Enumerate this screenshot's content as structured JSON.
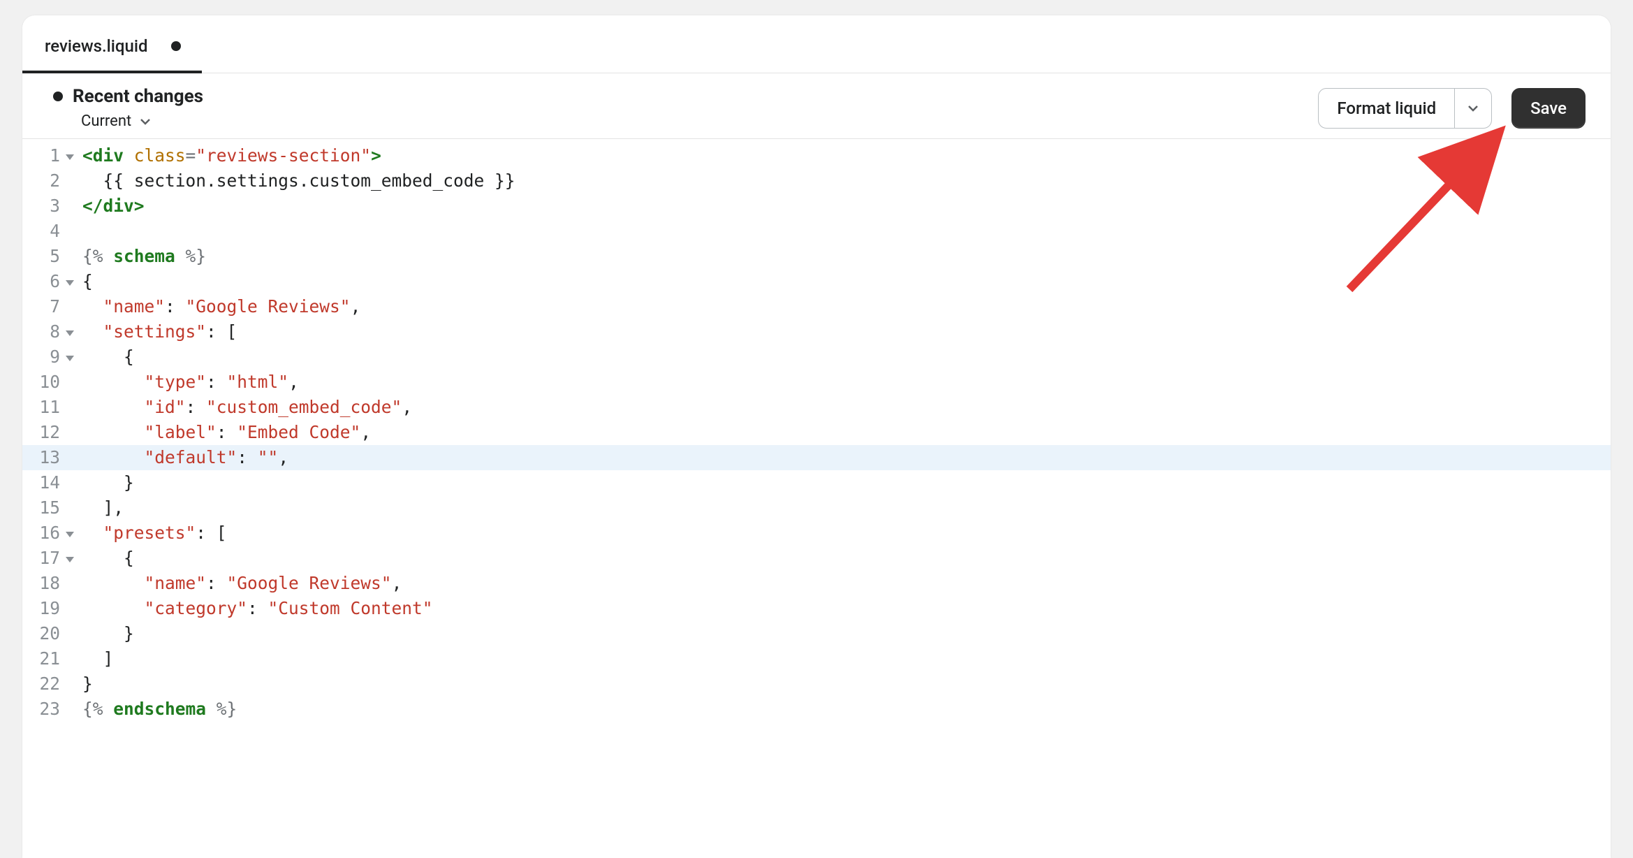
{
  "tab": {
    "filename": "reviews.liquid"
  },
  "toolbar": {
    "recent_title": "Recent changes",
    "current_label": "Current",
    "format_label": "Format liquid",
    "save_label": "Save"
  },
  "editor": {
    "highlighted_line": 13,
    "fold_lines": [
      1,
      6,
      8,
      9,
      16,
      17
    ],
    "lines": [
      {
        "num": 1,
        "tokens": [
          {
            "t": "<div ",
            "c": "tok-tag"
          },
          {
            "t": "class",
            "c": "tok-attr"
          },
          {
            "t": "=",
            "c": "tok-punct"
          },
          {
            "t": "\"reviews-section\"",
            "c": "tok-str"
          },
          {
            "t": ">",
            "c": "tok-tag"
          }
        ]
      },
      {
        "num": 2,
        "tokens": [
          {
            "t": "  {{ section.settings.custom_embed_code }}",
            "c": ""
          }
        ]
      },
      {
        "num": 3,
        "tokens": [
          {
            "t": "</div>",
            "c": "tok-tag"
          }
        ]
      },
      {
        "num": 4,
        "tokens": [
          {
            "t": "",
            "c": ""
          }
        ]
      },
      {
        "num": 5,
        "tokens": [
          {
            "t": "{% ",
            "c": "tok-punct"
          },
          {
            "t": "schema",
            "c": "tok-kw"
          },
          {
            "t": " %}",
            "c": "tok-punct"
          }
        ]
      },
      {
        "num": 6,
        "tokens": [
          {
            "t": "{",
            "c": ""
          }
        ]
      },
      {
        "num": 7,
        "tokens": [
          {
            "t": "  ",
            "c": ""
          },
          {
            "t": "\"name\"",
            "c": "tok-key"
          },
          {
            "t": ": ",
            "c": ""
          },
          {
            "t": "\"Google Reviews\"",
            "c": "tok-str"
          },
          {
            "t": ",",
            "c": ""
          }
        ]
      },
      {
        "num": 8,
        "tokens": [
          {
            "t": "  ",
            "c": ""
          },
          {
            "t": "\"settings\"",
            "c": "tok-key"
          },
          {
            "t": ": [",
            "c": ""
          }
        ]
      },
      {
        "num": 9,
        "tokens": [
          {
            "t": "    {",
            "c": ""
          }
        ]
      },
      {
        "num": 10,
        "tokens": [
          {
            "t": "      ",
            "c": ""
          },
          {
            "t": "\"type\"",
            "c": "tok-key"
          },
          {
            "t": ": ",
            "c": ""
          },
          {
            "t": "\"html\"",
            "c": "tok-str"
          },
          {
            "t": ",",
            "c": ""
          }
        ]
      },
      {
        "num": 11,
        "tokens": [
          {
            "t": "      ",
            "c": ""
          },
          {
            "t": "\"id\"",
            "c": "tok-key"
          },
          {
            "t": ": ",
            "c": ""
          },
          {
            "t": "\"custom_embed_code\"",
            "c": "tok-str"
          },
          {
            "t": ",",
            "c": ""
          }
        ]
      },
      {
        "num": 12,
        "tokens": [
          {
            "t": "      ",
            "c": ""
          },
          {
            "t": "\"label\"",
            "c": "tok-key"
          },
          {
            "t": ": ",
            "c": ""
          },
          {
            "t": "\"Embed Code\"",
            "c": "tok-str"
          },
          {
            "t": ",",
            "c": ""
          }
        ]
      },
      {
        "num": 13,
        "tokens": [
          {
            "t": "      ",
            "c": ""
          },
          {
            "t": "\"default\"",
            "c": "tok-key"
          },
          {
            "t": ": ",
            "c": ""
          },
          {
            "t": "\"\"",
            "c": "tok-str"
          },
          {
            "t": ",",
            "c": ""
          }
        ]
      },
      {
        "num": 14,
        "tokens": [
          {
            "t": "    }",
            "c": ""
          }
        ]
      },
      {
        "num": 15,
        "tokens": [
          {
            "t": "  ],",
            "c": ""
          }
        ]
      },
      {
        "num": 16,
        "tokens": [
          {
            "t": "  ",
            "c": ""
          },
          {
            "t": "\"presets\"",
            "c": "tok-key"
          },
          {
            "t": ": [",
            "c": ""
          }
        ]
      },
      {
        "num": 17,
        "tokens": [
          {
            "t": "    {",
            "c": ""
          }
        ]
      },
      {
        "num": 18,
        "tokens": [
          {
            "t": "      ",
            "c": ""
          },
          {
            "t": "\"name\"",
            "c": "tok-key"
          },
          {
            "t": ": ",
            "c": ""
          },
          {
            "t": "\"Google Reviews\"",
            "c": "tok-str"
          },
          {
            "t": ",",
            "c": ""
          }
        ]
      },
      {
        "num": 19,
        "tokens": [
          {
            "t": "      ",
            "c": ""
          },
          {
            "t": "\"category\"",
            "c": "tok-key"
          },
          {
            "t": ": ",
            "c": ""
          },
          {
            "t": "\"Custom Content\"",
            "c": "tok-str"
          }
        ]
      },
      {
        "num": 20,
        "tokens": [
          {
            "t": "    }",
            "c": ""
          }
        ]
      },
      {
        "num": 21,
        "tokens": [
          {
            "t": "  ]",
            "c": ""
          }
        ]
      },
      {
        "num": 22,
        "tokens": [
          {
            "t": "}",
            "c": ""
          }
        ]
      },
      {
        "num": 23,
        "tokens": [
          {
            "t": "{% ",
            "c": "tok-punct"
          },
          {
            "t": "endschema",
            "c": "tok-kw"
          },
          {
            "t": " %}",
            "c": "tok-punct"
          }
        ]
      }
    ]
  }
}
